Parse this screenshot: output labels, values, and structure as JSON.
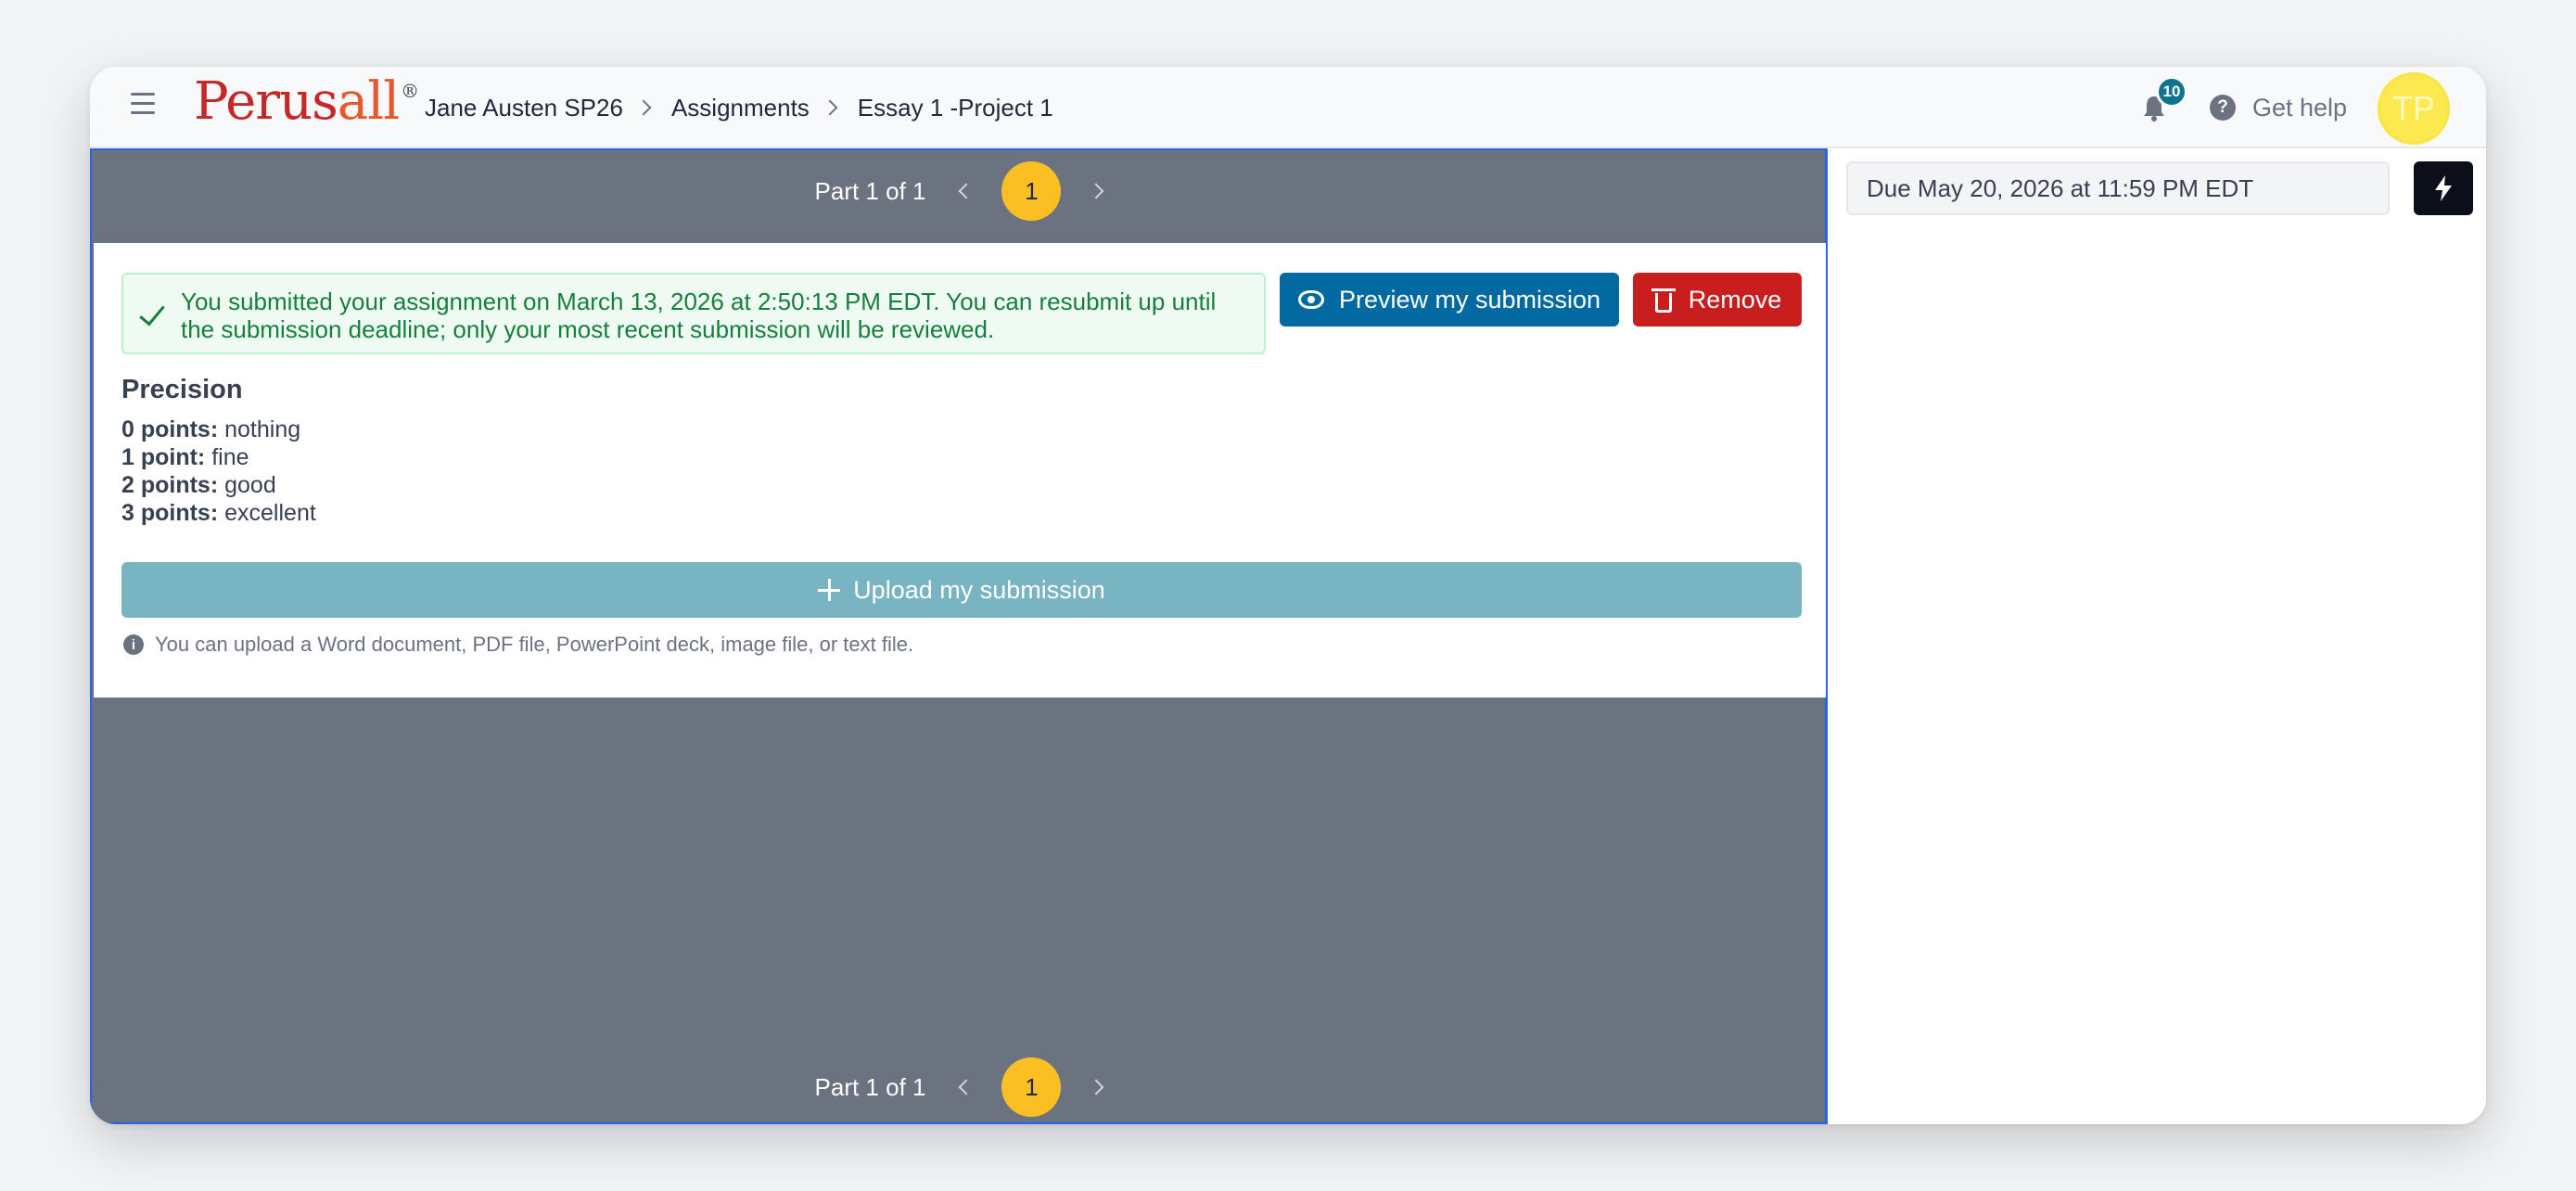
{
  "header": {
    "logo_main": "Perus",
    "logo_accent": "all",
    "logo_mark": "®",
    "breadcrumbs": [
      "Jane Austen SP26",
      "Assignments",
      "Essay 1 -Project 1"
    ],
    "notifications_count": "10",
    "help_label": "Get help",
    "avatar_initials": "TP"
  },
  "pager": {
    "label": "Part 1 of 1",
    "current_page": "1"
  },
  "submission": {
    "status_message": "You submitted your assignment on March 13, 2026 at 2:50:13 PM EDT. You can resubmit up until the submission deadline; only your most recent submission will be reviewed.",
    "preview_label": "Preview my submission",
    "remove_label": "Remove",
    "upload_label": "Upload my submission",
    "upload_note": "You can upload a Word document, PDF file, PowerPoint deck, image file, or text file."
  },
  "criteria": {
    "title": "Precision",
    "levels": [
      {
        "points": "0 points:",
        "desc": "nothing"
      },
      {
        "points": "1 point:",
        "desc": "fine"
      },
      {
        "points": "2 points:",
        "desc": "good"
      },
      {
        "points": "3 points:",
        "desc": "excellent"
      }
    ]
  },
  "sidebar": {
    "due_text": "Due May 20, 2026 at 11:59 PM EDT"
  },
  "icons": {
    "menu": "hamburger-menu-icon",
    "bell": "bell-icon",
    "help": "question-circle-icon",
    "check": "checkmark-icon",
    "eye": "eye-icon",
    "trash": "trash-icon",
    "plus": "plus-icon",
    "info": "info-circle-icon",
    "bolt": "lightning-bolt-icon"
  },
  "colors": {
    "primary": "#0369a1",
    "danger": "#c81e1e",
    "success": "#15803d",
    "page_accent": "#fbbf24",
    "upload": "#79b4c2"
  }
}
